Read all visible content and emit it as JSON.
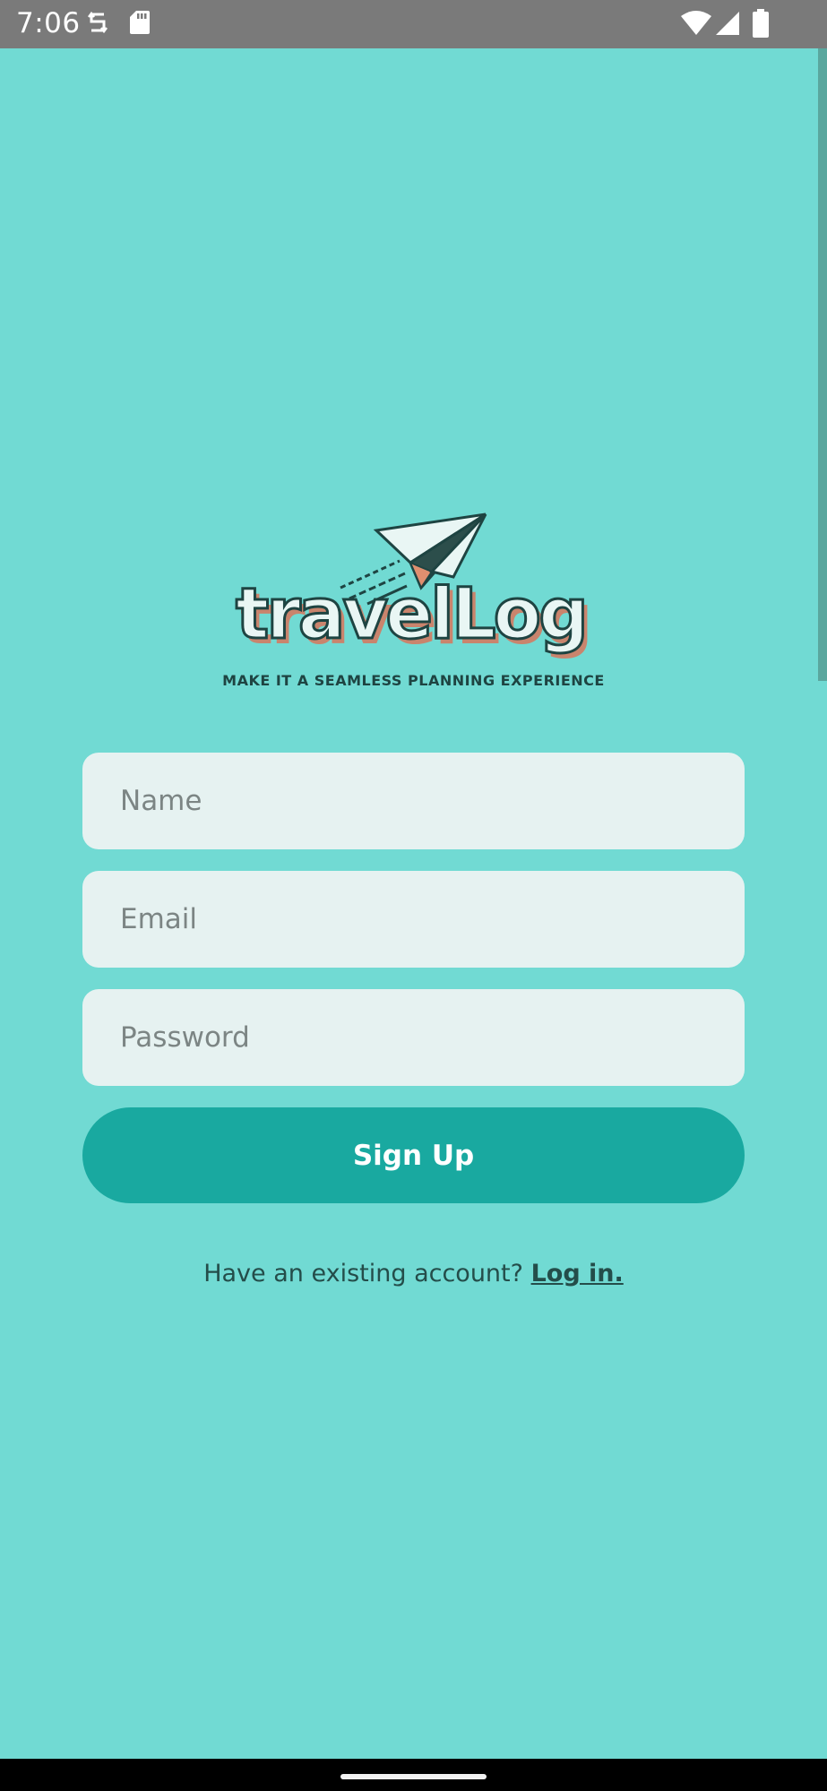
{
  "status_bar": {
    "time": "7:06",
    "left_icons": [
      "sync-icon",
      "sd-card-icon"
    ],
    "right_icons": [
      "wifi-icon",
      "signal-icon",
      "battery-icon"
    ]
  },
  "logo": {
    "wordmark": "travelLog",
    "icon": "paper-plane-icon"
  },
  "tagline": "MAKE IT A SEAMLESS PLANNING EXPERIENCE",
  "form": {
    "name_placeholder": "Name",
    "email_placeholder": "Email",
    "password_placeholder": "Password",
    "name_value": "",
    "email_value": "",
    "password_value": "",
    "submit_label": "Sign Up"
  },
  "footer": {
    "prompt": "Have an existing account?",
    "login_label": "Log in."
  },
  "colors": {
    "background": "#71dad3",
    "field": "#e6f2f1",
    "button": "#19a9a0",
    "text_dark": "#244d4a"
  }
}
